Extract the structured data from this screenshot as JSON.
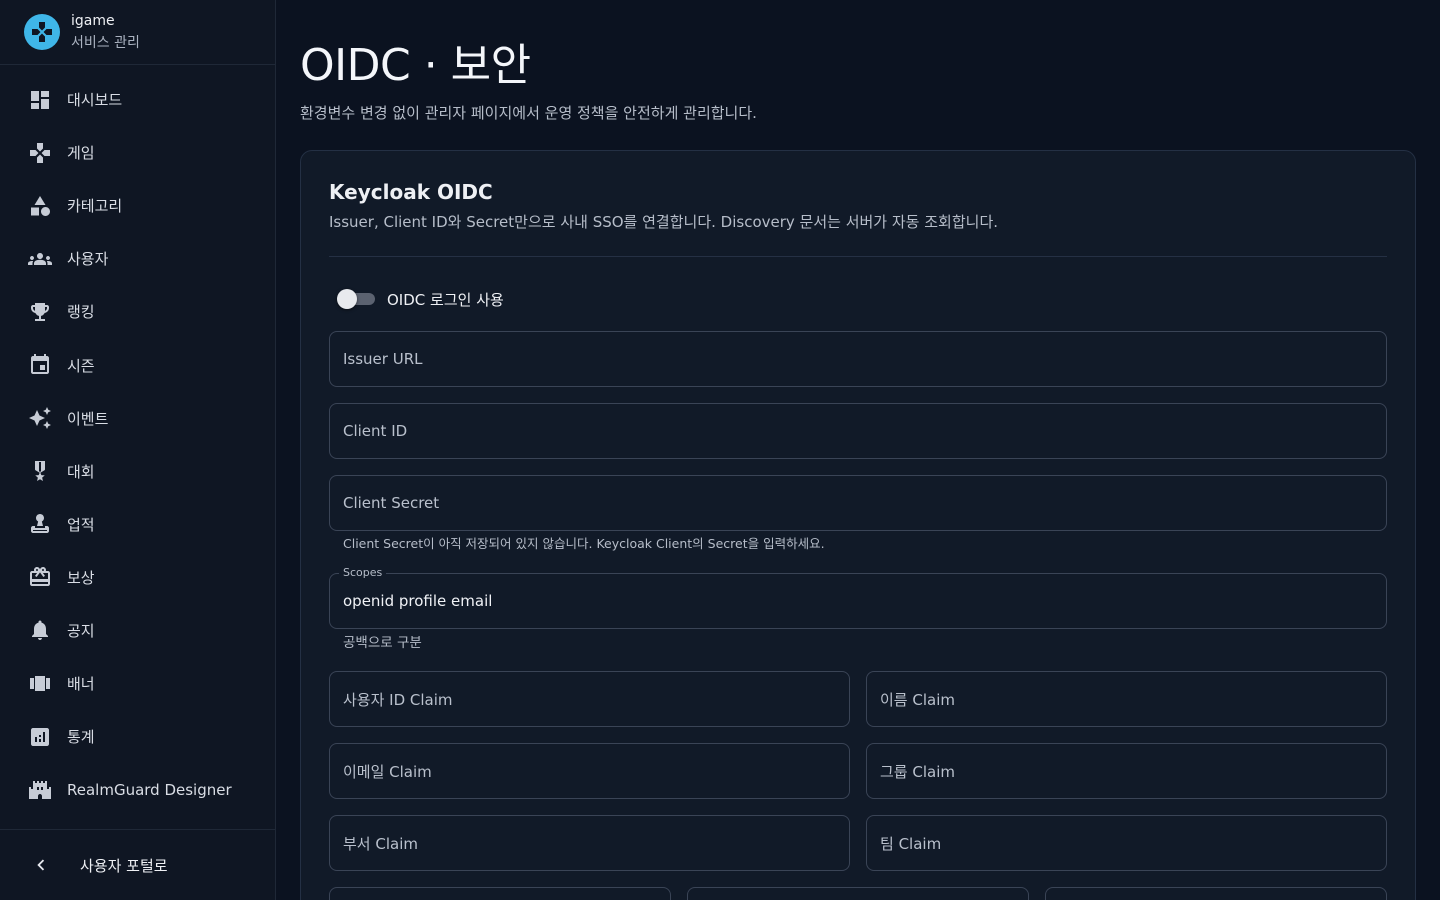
{
  "brand": {
    "name": "igame",
    "subtitle": "서비스 관리",
    "logo_icon": "gamepad-icon",
    "logo_color": "#3fb6e8"
  },
  "sidebar": {
    "items": [
      {
        "label": "대시보드",
        "icon": "dashboard-icon"
      },
      {
        "label": "게임",
        "icon": "gamepad-icon"
      },
      {
        "label": "카테고리",
        "icon": "category-icon"
      },
      {
        "label": "사용자",
        "icon": "users-icon"
      },
      {
        "label": "랭킹",
        "icon": "trophy-icon"
      },
      {
        "label": "시즌",
        "icon": "calendar-icon"
      },
      {
        "label": "이벤트",
        "icon": "sparkle-icon"
      },
      {
        "label": "대회",
        "icon": "medal-icon"
      },
      {
        "label": "업적",
        "icon": "achievement-icon"
      },
      {
        "label": "보상",
        "icon": "gift-icon"
      },
      {
        "label": "공지",
        "icon": "bell-icon"
      },
      {
        "label": "배너",
        "icon": "banner-icon"
      },
      {
        "label": "통계",
        "icon": "chart-icon"
      },
      {
        "label": "RealmGuard Designer",
        "icon": "castle-icon"
      }
    ],
    "footer": {
      "label": "사용자 포털로",
      "icon": "chevron-left-icon"
    }
  },
  "page": {
    "title": "OIDC · 보안",
    "description": "환경변수 변경 없이 관리자 페이지에서 운영 정책을 안전하게 관리합니다."
  },
  "card": {
    "title": "Keycloak OIDC",
    "description": "Issuer, Client ID와 Secret만으로 사내 SSO를 연결합니다. Discovery 문서는 서버가 자동 조회합니다.",
    "toggle": {
      "label": "OIDC 로그인 사용",
      "enabled": false
    },
    "fields": {
      "issuer_url": {
        "placeholder": "Issuer URL"
      },
      "client_id": {
        "placeholder": "Client ID"
      },
      "client_secret": {
        "placeholder": "Client Secret",
        "helper": "Client Secret이 아직 저장되어 있지 않습니다. Keycloak Client의 Secret을 입력하세요."
      },
      "scopes": {
        "label": "Scopes",
        "value": "openid profile email",
        "helper": "공백으로 구분"
      },
      "user_id_claim": {
        "placeholder": "사용자 ID Claim"
      },
      "name_claim": {
        "placeholder": "이름 Claim"
      },
      "email_claim": {
        "placeholder": "이메일 Claim"
      },
      "group_claim": {
        "placeholder": "그룹 Claim"
      },
      "department_claim": {
        "placeholder": "부서 Claim"
      },
      "team_claim": {
        "placeholder": "팀 Claim"
      }
    }
  }
}
